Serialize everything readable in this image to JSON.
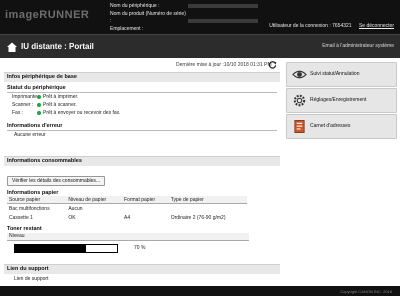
{
  "header": {
    "brand": "imageRUNNER",
    "fields": [
      {
        "label": "Nom du périphérique :"
      },
      {
        "label": "Nom du produit (Numéro de série) :"
      },
      {
        "label": "Emplacement :"
      }
    ],
    "login_text": "Utilisateur de la connexion : 7654321",
    "logout_label": "Se déconnecter"
  },
  "titlebar": {
    "title": "IU distante : Portail",
    "email_link": "Email à l'administrateur système"
  },
  "updated": "Dernière mise à jour :10/10 2018 01:31 PM",
  "device_info": {
    "section_title": "Infos périphérique de base",
    "status_title": "Statut du périphérique",
    "rows": [
      {
        "label": "Imprimante :",
        "value": "Prêt à imprimer."
      },
      {
        "label": "Scanner :",
        "value": "Prêt à scanner."
      },
      {
        "label": "Fax :",
        "value": "Prêt à envoyer ou recevoir des fax."
      }
    ],
    "status_color": "#1fa645",
    "error_title": "Informations d'erreur",
    "error_value": "Aucune erreur"
  },
  "consumables": {
    "section_title": "Informations consommables",
    "check_button": "Vérifier les détails des consommables...",
    "paper_title": "Informations papier",
    "paper_columns": [
      "Source papier",
      "Niveau de papier",
      "Format papier",
      "Type de papier"
    ],
    "paper_rows": [
      [
        "Bac multifonctions",
        "Aucun",
        "",
        ""
      ],
      [
        "Cassette 1",
        "OK",
        "A4",
        "Ordinaire 2 (76-90 g/m2)"
      ]
    ],
    "toner_title": "Toner restant",
    "toner_column": "Niveau",
    "toner_percent": 70,
    "toner_label": "70 %"
  },
  "support": {
    "section_title": "Lien du support",
    "link": "Lien de support"
  },
  "side_menu": [
    {
      "label": "Suivi statut/Annulation",
      "icon": "status-monitor-icon"
    },
    {
      "label": "Réglages/Enregistrement",
      "icon": "settings-icon"
    },
    {
      "label": "Carnet d'adresses",
      "icon": "address-book-icon"
    }
  ],
  "footer": {
    "copyright": "Copyright CANON INC. 2018"
  }
}
